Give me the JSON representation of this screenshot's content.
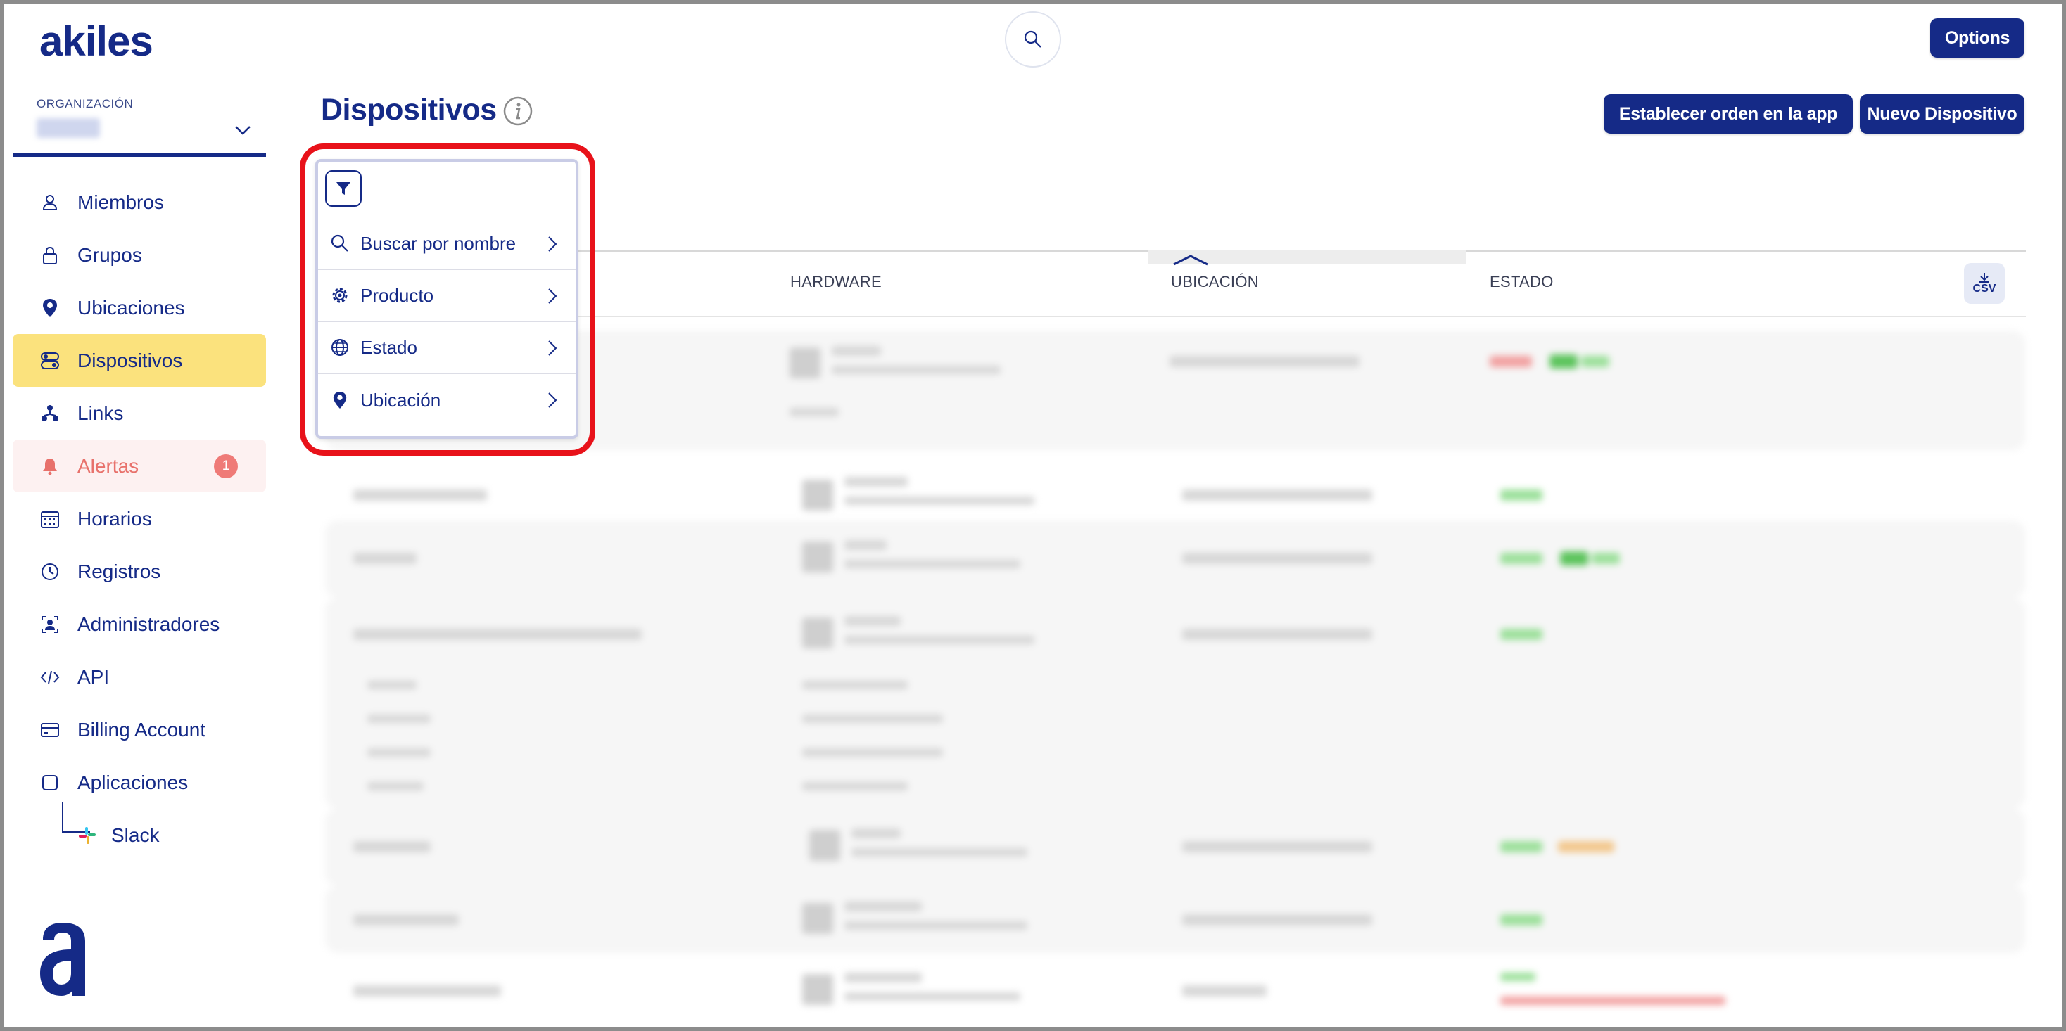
{
  "brand": {
    "logo": "akiles"
  },
  "organization": {
    "label": "ORGANIZACIÓN"
  },
  "sidebar": {
    "items": [
      {
        "label": "Miembros",
        "icon": "person-icon"
      },
      {
        "label": "Grupos",
        "icon": "lock-icon"
      },
      {
        "label": "Ubicaciones",
        "icon": "location-pin-icon"
      },
      {
        "label": "Dispositivos",
        "icon": "device-icon",
        "active": true
      },
      {
        "label": "Links",
        "icon": "share-people-icon"
      },
      {
        "label": "Alertas",
        "icon": "bell-icon",
        "badge": "1"
      },
      {
        "label": "Horarios",
        "icon": "calendar-icon"
      },
      {
        "label": "Registros",
        "icon": "clock-icon"
      },
      {
        "label": "Administradores",
        "icon": "admin-icon"
      },
      {
        "label": "API",
        "icon": "code-icon"
      },
      {
        "label": "Billing Account",
        "icon": "card-icon"
      },
      {
        "label": "Aplicaciones",
        "icon": "square-icon"
      }
    ],
    "subitems": [
      {
        "label": "Slack",
        "icon": "slack-icon"
      }
    ]
  },
  "header": {
    "options_label": "Options",
    "search_icon": "search-icon"
  },
  "page": {
    "title": "Dispositivos",
    "set_order_label": "Establecer orden en la app",
    "new_device_label": "Nuevo Dispositivo"
  },
  "table": {
    "columns": [
      "HARDWARE",
      "UBICACIÓN",
      "ESTADO"
    ],
    "csv_label": "CSV"
  },
  "filter_popover": {
    "items": [
      {
        "label": "Buscar por nombre",
        "icon": "search-icon"
      },
      {
        "label": "Producto",
        "icon": "gear-icon"
      },
      {
        "label": "Estado",
        "icon": "globe-icon"
      },
      {
        "label": "Ubicación",
        "icon": "location-pin-icon"
      }
    ]
  },
  "colors": {
    "primary": "#152a87",
    "active_bg": "#fbe27d",
    "alert_text": "#e8716b",
    "alert_bg": "#fdf1f1",
    "badge": "#ef7a77",
    "highlight": "#e8121a"
  }
}
